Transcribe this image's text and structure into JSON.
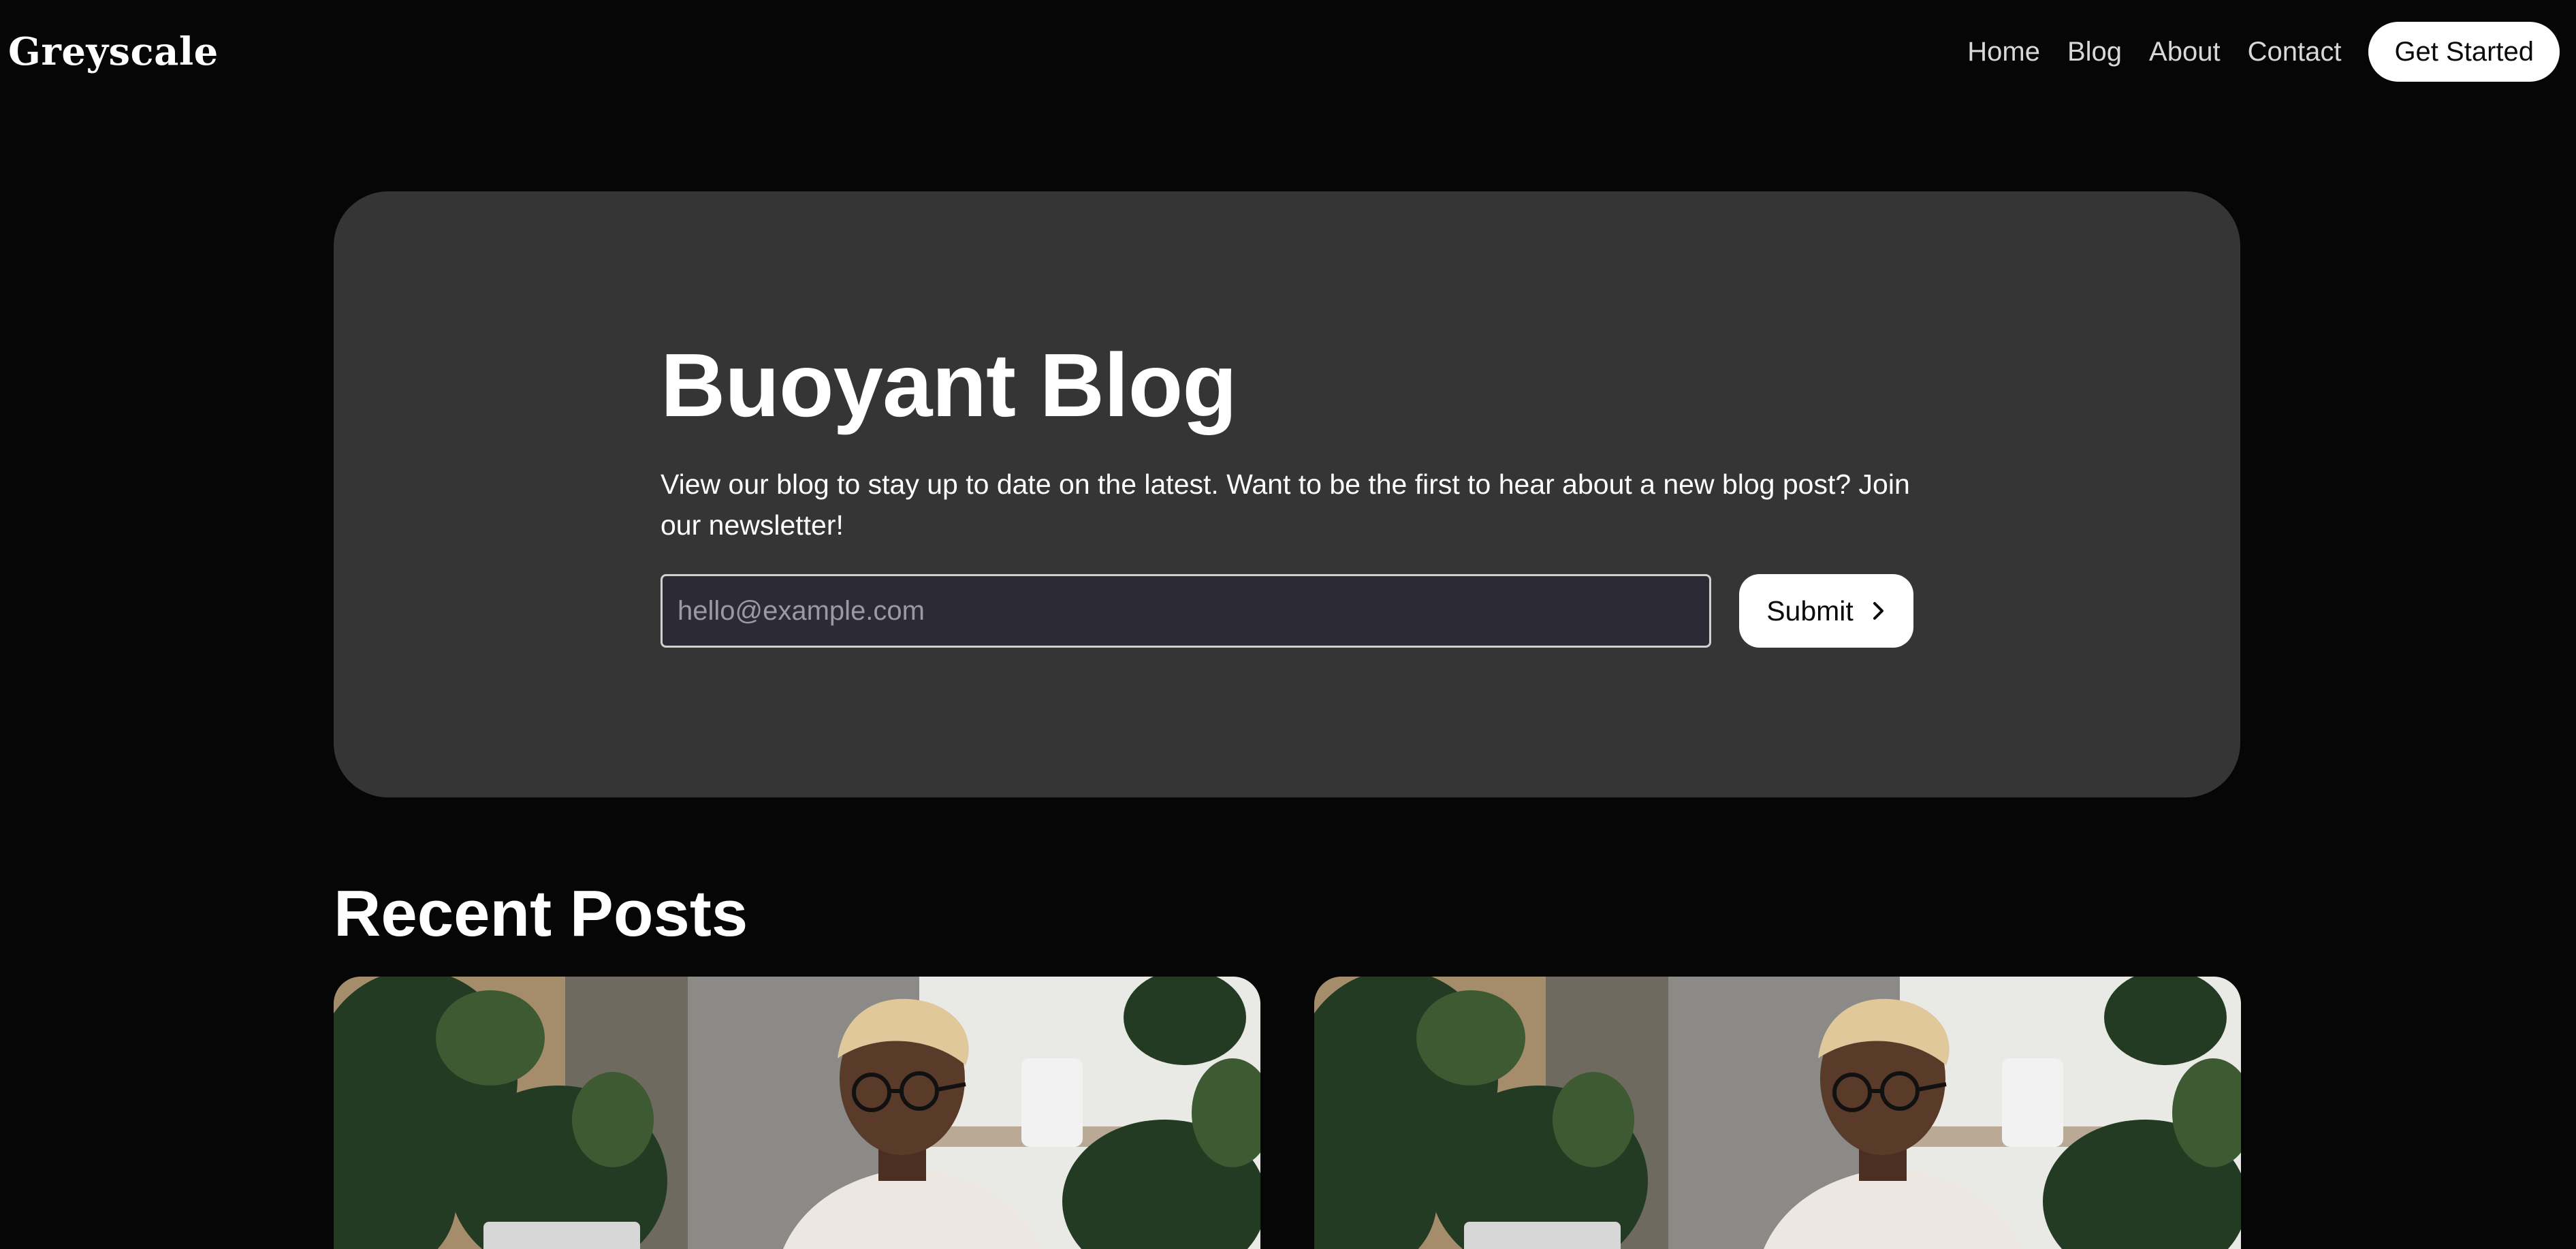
{
  "header": {
    "brand": "Greyscale",
    "nav": [
      {
        "label": "Home"
      },
      {
        "label": "Blog"
      },
      {
        "label": "About"
      },
      {
        "label": "Contact"
      }
    ],
    "cta_label": "Get Started"
  },
  "hero": {
    "title": "Buoyant Blog",
    "description": "View our blog to stay up to date on the latest. Want to be the first to hear about a new blog post? Join our newsletter!",
    "email_placeholder": "hello@example.com",
    "email_value": "",
    "submit_label": "Submit",
    "submit_icon": "chevron-right-icon"
  },
  "recent": {
    "title": "Recent Posts",
    "posts": [
      {
        "image": "man-with-glasses-laptop-plants-photo"
      },
      {
        "image": "man-with-glasses-laptop-plants-photo"
      }
    ]
  },
  "colors": {
    "page_bg": "#060606",
    "hero_bg": "#353535",
    "input_bg": "#2c2b35",
    "button_bg": "#ffffff",
    "text": "#ffffff"
  }
}
